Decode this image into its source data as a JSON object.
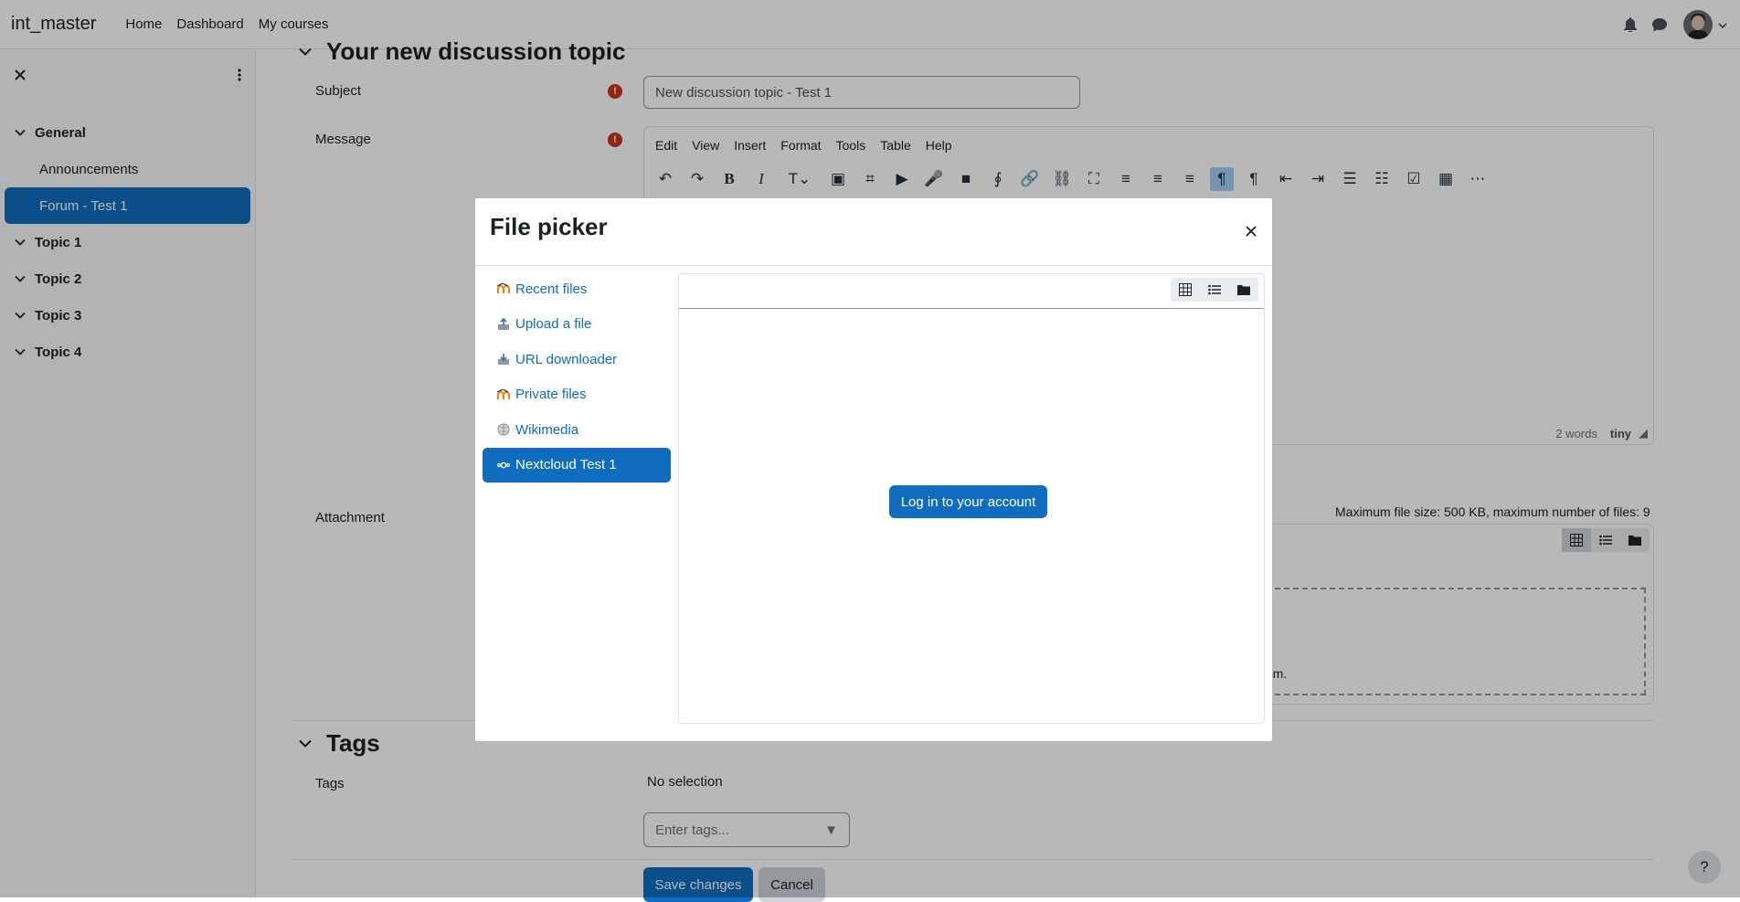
{
  "navbar": {
    "brand": "int_master",
    "links": [
      "Home",
      "Dashboard",
      "My courses"
    ],
    "icons": [
      "bell-icon",
      "chat-icon",
      "avatar",
      "chevron-down-icon"
    ]
  },
  "drawer": {
    "sections": [
      {
        "label": "General",
        "items": [
          "Announcements",
          "Forum - Test 1"
        ]
      },
      {
        "label": "Topic 1"
      },
      {
        "label": "Topic 2"
      },
      {
        "label": "Topic 3"
      },
      {
        "label": "Topic 4"
      }
    ],
    "active_item": "Forum - Test 1"
  },
  "form": {
    "section_title": "Your new discussion topic",
    "subject_label": "Subject",
    "subject_value": "New discussion topic - Test 1",
    "message_label": "Message",
    "editor_menu": [
      "Edit",
      "View",
      "Insert",
      "Format",
      "Tools",
      "Table",
      "Help"
    ],
    "word_count": "2 words",
    "tiny_brand": "tiny",
    "attachment_label": "Attachment",
    "max_file_text": "Maximum file size: 500 KB, maximum number of files: 9",
    "dropzone_fragment": "hem.",
    "tags_section_title": "Tags",
    "tags_label": "Tags",
    "tags_selection": "No selection",
    "tags_placeholder": "Enter tags...",
    "save_label": "Save changes",
    "cancel_label": "Cancel",
    "help_label": "?"
  },
  "modal": {
    "title": "File picker",
    "repositories": [
      {
        "label": "Recent files",
        "icon": "moodle-icon"
      },
      {
        "label": "Upload a file",
        "icon": "upload-icon"
      },
      {
        "label": "URL downloader",
        "icon": "url-icon"
      },
      {
        "label": "Private files",
        "icon": "moodle-icon"
      },
      {
        "label": "Wikimedia",
        "icon": "wikimedia-icon"
      },
      {
        "label": "Nextcloud Test 1",
        "icon": "nextcloud-icon"
      }
    ],
    "active_repository": "Nextcloud Test 1",
    "login_label": "Log in to your account"
  },
  "colors": {
    "primary": "#0f6cbf",
    "required": "#ca3120",
    "backdrop": "rgba(0,0,0,0.28)"
  }
}
